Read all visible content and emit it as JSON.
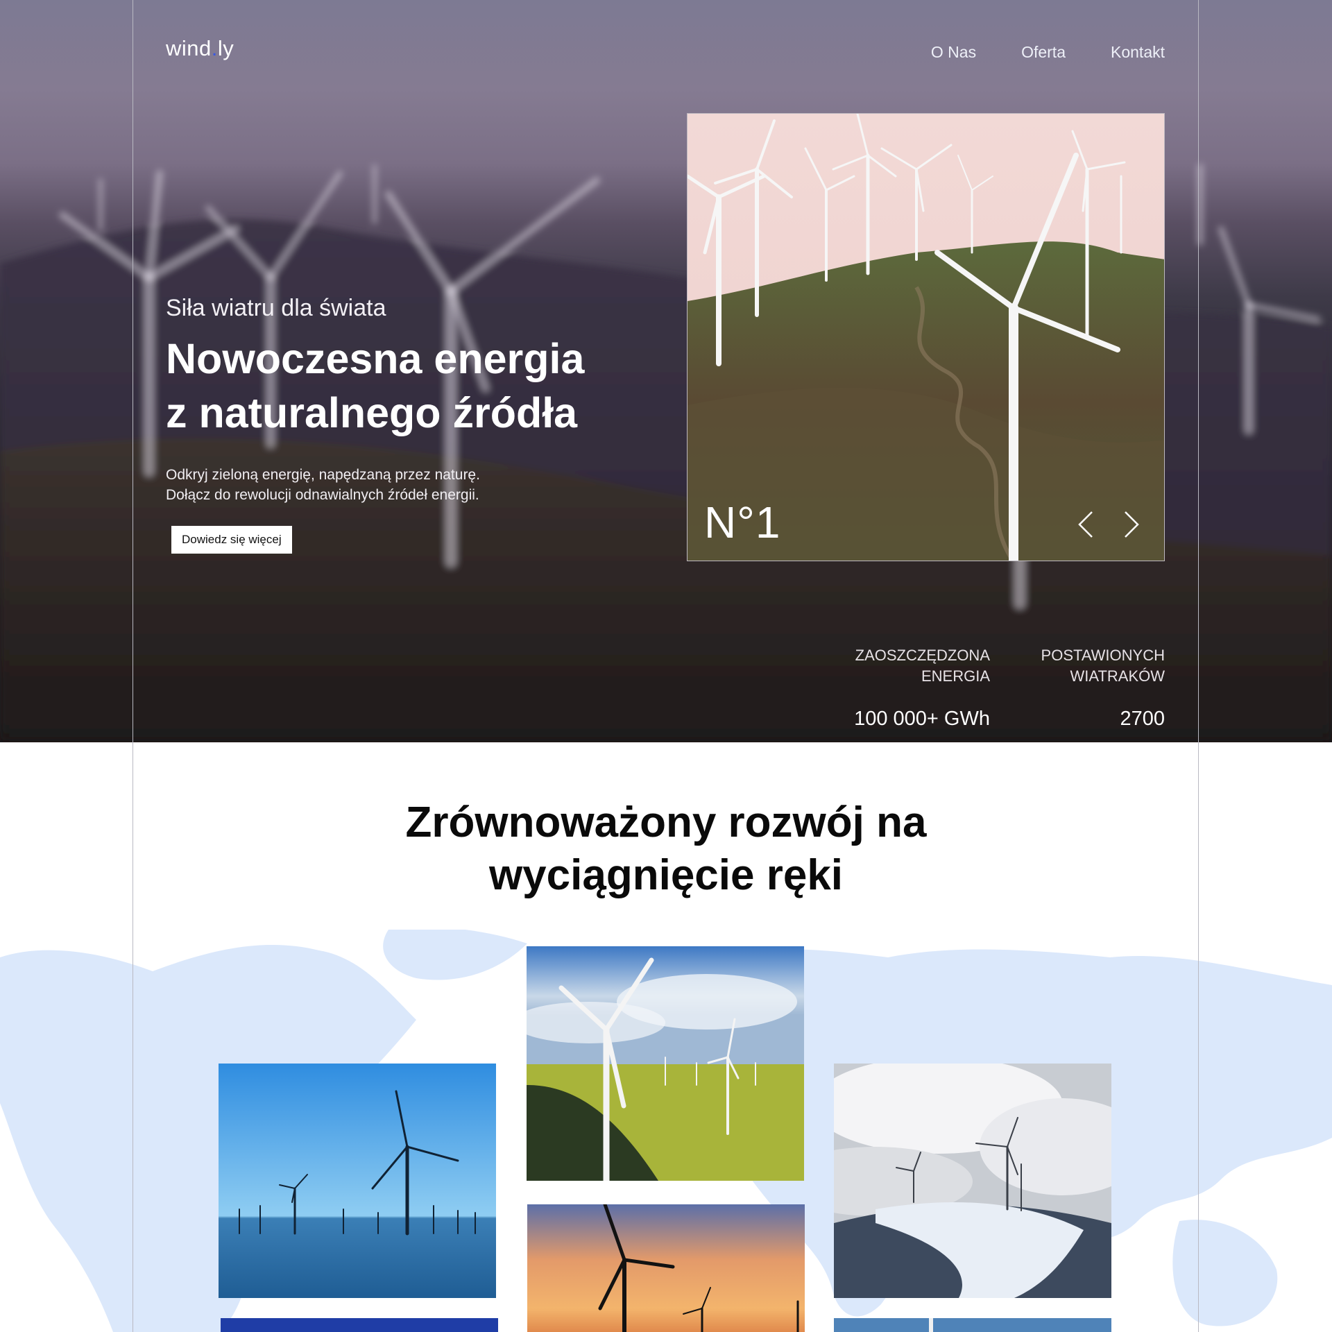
{
  "brand": {
    "name_part1": "wind",
    "dot": ".",
    "name_part2": "ly"
  },
  "nav": {
    "items": [
      "O Nas",
      "Oferta",
      "Kontakt"
    ]
  },
  "hero": {
    "subtitle": "Siła wiatru dla świata",
    "headline_line1": "Nowoczesna energia",
    "headline_line2": "z naturalnego źródła",
    "lead_line1": "Odkryj zieloną energię, napędzaną przez naturę.",
    "lead_line2": "Dołącz do rewolucji odnawialnych źródeł energii.",
    "cta_label": "Dowiedz się więcej"
  },
  "slider": {
    "label": "N°1"
  },
  "stats": [
    {
      "label_line1": "ZAOSZCZĘDZONA",
      "label_line2": "ENERGIA",
      "value": "100 000+ GWh"
    },
    {
      "label_line1": "POSTAWIONYCH",
      "label_line2": "WIATRAKÓW",
      "value": "2700"
    }
  ],
  "section": {
    "title_line1": "Zrównoważony rozwój na",
    "title_line2": "wyciągnięcie ręki"
  },
  "colors": {
    "accent_dot": "#3a59e0",
    "map": "#dbe8fb"
  }
}
